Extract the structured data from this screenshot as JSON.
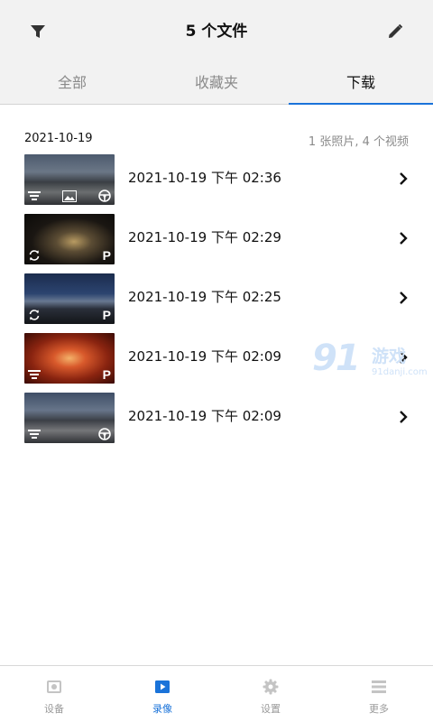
{
  "header": {
    "title": "5 个文件",
    "filter_icon": "filter-icon",
    "edit_icon": "pencil-icon"
  },
  "tabs": [
    {
      "label": "全部",
      "active": false
    },
    {
      "label": "收藏夹",
      "active": false
    },
    {
      "label": "下载",
      "active": true
    }
  ],
  "section": {
    "date": "2021-10-19",
    "count": "1 张照片, 4 个视频"
  },
  "files": [
    {
      "label": "2021-10-19 下午 02:36",
      "icons": [
        "list-icon",
        "photo-icon",
        "steering-wheel-icon"
      ]
    },
    {
      "label": "2021-10-19 下午 02:29",
      "icons": [
        "loop-icon",
        "parking-icon"
      ]
    },
    {
      "label": "2021-10-19 下午 02:25",
      "icons": [
        "loop-icon",
        "parking-icon"
      ]
    },
    {
      "label": "2021-10-19 下午 02:09",
      "icons": [
        "list-icon",
        "parking-icon"
      ]
    },
    {
      "label": "2021-10-19 下午 02:09",
      "icons": [
        "list-icon",
        "steering-wheel-icon"
      ]
    }
  ],
  "parking_mark": "P",
  "watermark": {
    "logo": "91",
    "name": "游戏",
    "site": "91danji.com"
  },
  "bottom_nav": [
    {
      "label": "设备",
      "icon": "camera-icon",
      "active": false
    },
    {
      "label": "录像",
      "icon": "play-icon",
      "active": true
    },
    {
      "label": "设置",
      "icon": "gear-icon",
      "active": false
    },
    {
      "label": "更多",
      "icon": "menu-icon",
      "active": false
    }
  ],
  "colors": {
    "accent": "#1a73d9",
    "header_bg": "#f2f2f2",
    "muted_text": "#8a8a8a"
  }
}
